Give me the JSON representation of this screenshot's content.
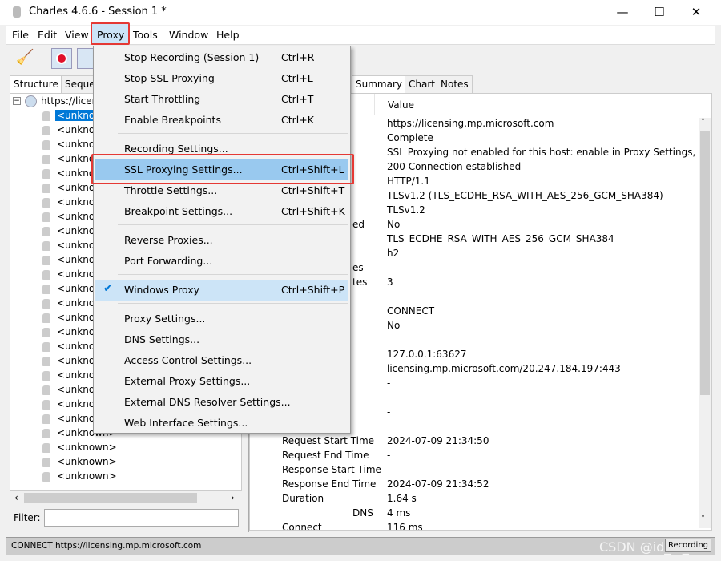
{
  "window": {
    "title": "Charles 4.6.6 - Session 1 *",
    "minimize": "—",
    "maximize": "☐",
    "close": "✕"
  },
  "menubar": [
    "File",
    "Edit",
    "View",
    "Proxy",
    "Tools",
    "Window",
    "Help"
  ],
  "left": {
    "tabs": [
      "Structure",
      "Seque"
    ],
    "host": "https://licen",
    "selected": "<unknow",
    "items": [
      "<unknov",
      "<unkno",
      "<unkno",
      "<unkno",
      "<unkno",
      "<unkno",
      "<unkno",
      "<unkno",
      "<unkno",
      "<unkno",
      "<unkno",
      "<unkno",
      "<unkno",
      "<unkno",
      "<unkno",
      "<unkno",
      "<unkno",
      "<unkno",
      "<unkno",
      "<unkno",
      "<unknow",
      "<unknown>",
      "<unknown>",
      "<unknown>",
      "<unknown>"
    ],
    "filter_label": "Filter:",
    "filter_value": ""
  },
  "right": {
    "tabs": [
      "Summary",
      "Chart",
      "Notes"
    ],
    "value_header": "Value",
    "rows": [
      [
        "",
        "https://licensing.mp.microsoft.com"
      ],
      [
        "",
        "Complete"
      ],
      [
        "",
        "SSL Proxying not enabled for this host: enable in Proxy Settings, ..."
      ],
      [
        "",
        "200 Connection established"
      ],
      [
        "",
        "HTTP/1.1"
      ],
      [
        "",
        "TLSv1.2 (TLS_ECDHE_RSA_WITH_AES_256_GCM_SHA384)"
      ],
      [
        "",
        "TLSv1.2"
      ],
      [
        "ed",
        "No"
      ],
      [
        "",
        "TLS_ECDHE_RSA_WITH_AES_256_GCM_SHA384"
      ],
      [
        "",
        "h2"
      ],
      [
        "es",
        "-"
      ],
      [
        "tes",
        "3"
      ],
      [
        "",
        ""
      ],
      [
        "",
        "CONNECT"
      ],
      [
        "",
        "No"
      ],
      [
        "",
        ""
      ],
      [
        "",
        "127.0.0.1:63627"
      ],
      [
        "",
        "licensing.mp.microsoft.com/20.247.184.197:443"
      ],
      [
        "",
        "-"
      ],
      [
        "",
        ""
      ],
      [
        "",
        "-"
      ],
      [
        "",
        ""
      ],
      [
        "Request Start Time",
        "2024-07-09 21:34:50"
      ],
      [
        "Request End Time",
        "-"
      ],
      [
        "Response Start Time",
        "-"
      ],
      [
        "Response End Time",
        "2024-07-09 21:34:52"
      ],
      [
        "Duration",
        "1.64 s"
      ],
      [
        "DNS",
        "4 ms"
      ],
      [
        "Connect",
        "116 ms"
      ]
    ]
  },
  "proxy_menu": {
    "items": [
      {
        "label": "Stop Recording (Session 1)",
        "shortcut": "Ctrl+R"
      },
      {
        "label": "Stop SSL Proxying",
        "shortcut": "Ctrl+L"
      },
      {
        "label": "Start Throttling",
        "shortcut": "Ctrl+T"
      },
      {
        "label": "Enable Breakpoints",
        "shortcut": "Ctrl+K"
      },
      {
        "label": "Recording Settings...",
        "shortcut": ""
      },
      {
        "label": "SSL Proxying Settings...",
        "shortcut": "Ctrl+Shift+L",
        "highlighted": true
      },
      {
        "label": "Throttle Settings...",
        "shortcut": "Ctrl+Shift+T"
      },
      {
        "label": "Breakpoint Settings...",
        "shortcut": "Ctrl+Shift+K"
      },
      {
        "label": "Reverse Proxies...",
        "shortcut": ""
      },
      {
        "label": "Port Forwarding...",
        "shortcut": ""
      },
      {
        "label": "Windows Proxy",
        "shortcut": "Ctrl+Shift+P",
        "checked": true
      },
      {
        "label": "Proxy Settings...",
        "shortcut": ""
      },
      {
        "label": "DNS Settings...",
        "shortcut": ""
      },
      {
        "label": "Access Control Settings...",
        "shortcut": ""
      },
      {
        "label": "External Proxy Settings...",
        "shortcut": ""
      },
      {
        "label": "External DNS Resolver Settings...",
        "shortcut": ""
      },
      {
        "label": "Web Interface Settings...",
        "shortcut": ""
      }
    ]
  },
  "status": {
    "text": "CONNECT https://licensing.mp.microsoft.com",
    "recording": "Recording",
    "watermark": "CSDN @id_id_id"
  },
  "colors": {
    "highlight": "#99c9ef",
    "selection": "#0078d7",
    "annotation": "#e53935"
  }
}
